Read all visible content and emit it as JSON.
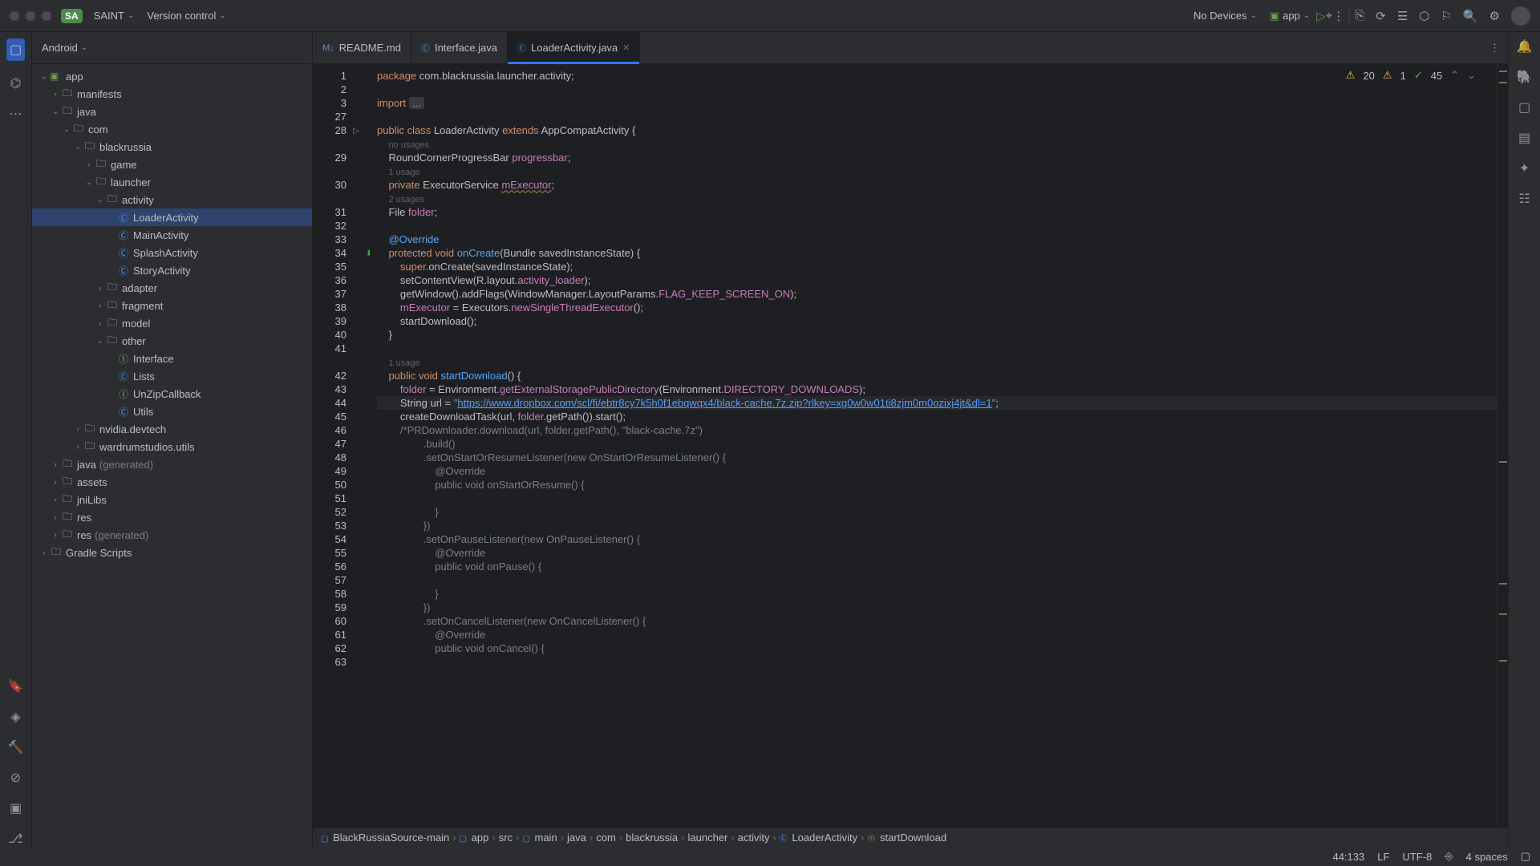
{
  "titlebar": {
    "badge": "SA",
    "workspace": "SAINT",
    "vcs": "Version control",
    "devices": "No Devices",
    "runconfig": "app"
  },
  "sidebar": {
    "header": "Android",
    "tree": [
      {
        "d": 0,
        "t": "v",
        "i": "app",
        "l": "app"
      },
      {
        "d": 1,
        "t": ">",
        "i": "folder",
        "l": "manifests"
      },
      {
        "d": 1,
        "t": "v",
        "i": "folder",
        "l": "java"
      },
      {
        "d": 2,
        "t": "v",
        "i": "folder",
        "l": "com"
      },
      {
        "d": 3,
        "t": "v",
        "i": "folder",
        "l": "blackrussia"
      },
      {
        "d": 4,
        "t": ">",
        "i": "folder",
        "l": "game"
      },
      {
        "d": 4,
        "t": "v",
        "i": "folder",
        "l": "launcher"
      },
      {
        "d": 5,
        "t": "v",
        "i": "folder",
        "l": "activity"
      },
      {
        "d": 6,
        "t": "",
        "i": "cls",
        "l": "LoaderActivity",
        "sel": true
      },
      {
        "d": 6,
        "t": "",
        "i": "cls",
        "l": "MainActivity"
      },
      {
        "d": 6,
        "t": "",
        "i": "cls",
        "l": "SplashActivity"
      },
      {
        "d": 6,
        "t": "",
        "i": "cls",
        "l": "StoryActivity"
      },
      {
        "d": 5,
        "t": ">",
        "i": "folder",
        "l": "adapter"
      },
      {
        "d": 5,
        "t": ">",
        "i": "folder",
        "l": "fragment"
      },
      {
        "d": 5,
        "t": ">",
        "i": "folder",
        "l": "model"
      },
      {
        "d": 5,
        "t": "v",
        "i": "folder",
        "l": "other"
      },
      {
        "d": 6,
        "t": "",
        "i": "iface",
        "l": "Interface"
      },
      {
        "d": 6,
        "t": "",
        "i": "cls",
        "l": "Lists"
      },
      {
        "d": 6,
        "t": "",
        "i": "iface",
        "l": "UnZipCallback"
      },
      {
        "d": 6,
        "t": "",
        "i": "cls",
        "l": "Utils"
      },
      {
        "d": 3,
        "t": ">",
        "i": "folder",
        "l": "nvidia.devtech"
      },
      {
        "d": 3,
        "t": ">",
        "i": "folder",
        "l": "wardrumstudios.utils"
      },
      {
        "d": 1,
        "t": ">",
        "i": "folder",
        "l": "java",
        "dim": "(generated)"
      },
      {
        "d": 1,
        "t": ">",
        "i": "folder",
        "l": "assets"
      },
      {
        "d": 1,
        "t": ">",
        "i": "folder",
        "l": "jniLibs"
      },
      {
        "d": 1,
        "t": ">",
        "i": "folder",
        "l": "res"
      },
      {
        "d": 1,
        "t": ">",
        "i": "folder",
        "l": "res",
        "dim": "(generated)"
      },
      {
        "d": 0,
        "t": ">",
        "i": "folder",
        "l": "Gradle Scripts"
      }
    ]
  },
  "tabs": [
    {
      "icon": "md",
      "label": "README.md",
      "active": false
    },
    {
      "icon": "java",
      "label": "Interface.java",
      "active": false
    },
    {
      "icon": "java",
      "label": "LoaderActivity.java",
      "active": true,
      "close": true
    }
  ],
  "inspections": {
    "warnings": "20",
    "weak": "1",
    "typos": "45"
  },
  "code": [
    {
      "n": 1,
      "h": "<span class='kw'>package</span> com.blackrussia.launcher.activity;"
    },
    {
      "n": 2,
      "h": ""
    },
    {
      "n": 3,
      "h": "<span class='kw'>import</span> <span class='fold'>...</span>"
    },
    {
      "n": 27,
      "h": ""
    },
    {
      "n": 28,
      "run": true,
      "h": "<span class='kw'>public class</span> LoaderActivity <span class='kw'>extends</span> AppCompatActivity {"
    },
    {
      "hint": "no usages"
    },
    {
      "n": 29,
      "h": "    RoundCornerProgressBar <span class='fld'>progressbar</span>;"
    },
    {
      "hint": "1 usage"
    },
    {
      "n": 30,
      "h": "    <span class='kw'>private</span> ExecutorService <span class='fld warn'>mExecutor</span>;"
    },
    {
      "hint": "2 usages"
    },
    {
      "n": 31,
      "h": "    File <span class='fld'>folder</span>;"
    },
    {
      "n": 32,
      "h": ""
    },
    {
      "n": 33,
      "h": "    <span class='fn'>@Override</span>"
    },
    {
      "n": 34,
      "ov": true,
      "h": "    <span class='kw'>protected void</span> <span class='fn'>onCreate</span>(Bundle savedInstanceState) {"
    },
    {
      "n": 35,
      "h": "        <span class='kw'>super</span>.onCreate(savedInstanceState);"
    },
    {
      "n": 36,
      "h": "        setContentView(R.layout.<span class='fld'>activity_loader</span>);"
    },
    {
      "n": 37,
      "h": "        getWindow().addFlags(WindowManager.LayoutParams.<span class='fld'>FLAG_KEEP_SCREEN_ON</span>);"
    },
    {
      "n": 38,
      "h": "        <span class='fld'>mExecutor</span> = Executors.<span class='fld'>newSingleThreadExecutor</span>();"
    },
    {
      "n": 39,
      "h": "        startDownload();"
    },
    {
      "n": 40,
      "h": "    }"
    },
    {
      "n": 41,
      "h": ""
    },
    {
      "hint": "1 usage"
    },
    {
      "n": 42,
      "h": "    <span class='kw'>public void</span> <span class='fn'>startDownload</span>() {"
    },
    {
      "n": 43,
      "h": "        <span class='fld'>folder</span> = Environment.<span class='fld'>getExternalStoragePublicDirectory</span>(Environment.<span class='fld'>DIRECTORY_DOWNLOADS</span>);"
    },
    {
      "n": 44,
      "cur": true,
      "h": "        String url = <span class='str'>\"</span><span class='url'>https://www.dropbox.com/scl/fi/ebtr8cy7k5h0f1ebqwqx4/black-cache.7z.zip?rlkey=xg0w0w01ti8zjm0m0ozixj4jt&dl=1</span><span class='str'>\"</span>;"
    },
    {
      "n": 45,
      "h": "        createDownloadTask(url, <span class='fld'>folder</span>.getPath()).start();"
    },
    {
      "n": 46,
      "h": "        <span class='cmt'>/*PRDownloader.download(url, folder.getPath(), \"black-cache.7z\")</span>"
    },
    {
      "n": 47,
      "h": "<span class='cmt'>                .build()</span>"
    },
    {
      "n": 48,
      "h": "<span class='cmt'>                .setOnStartOrResumeListener(new OnStartOrResumeListener() {</span>"
    },
    {
      "n": 49,
      "h": "<span class='cmt'>                    @Override</span>"
    },
    {
      "n": 50,
      "h": "<span class='cmt'>                    public void onStartOrResume() {</span>"
    },
    {
      "n": 51,
      "h": ""
    },
    {
      "n": 52,
      "h": "<span class='cmt'>                    }</span>"
    },
    {
      "n": 53,
      "h": "<span class='cmt'>                })</span>"
    },
    {
      "n": 54,
      "h": "<span class='cmt'>                .setOnPauseListener(new OnPauseListener() {</span>"
    },
    {
      "n": 55,
      "h": "<span class='cmt'>                    @Override</span>"
    },
    {
      "n": 56,
      "h": "<span class='cmt'>                    public void onPause() {</span>"
    },
    {
      "n": 57,
      "h": ""
    },
    {
      "n": 58,
      "h": "<span class='cmt'>                    }</span>"
    },
    {
      "n": 59,
      "h": "<span class='cmt'>                })</span>"
    },
    {
      "n": 60,
      "h": "<span class='cmt'>                .setOnCancelListener(new OnCancelListener() {</span>"
    },
    {
      "n": 61,
      "h": "<span class='cmt'>                    @Override</span>"
    },
    {
      "n": 62,
      "h": "<span class='cmt'>                    public void onCancel() {</span>"
    },
    {
      "n": 63,
      "h": ""
    }
  ],
  "crumbs": [
    "BlackRussiaSource-main",
    "app",
    "src",
    "main",
    "java",
    "com",
    "blackrussia",
    "launcher",
    "activity",
    "LoaderActivity",
    "startDownload"
  ],
  "status": {
    "pos": "44:133",
    "le": "LF",
    "enc": "UTF-8",
    "indent": "4 spaces"
  }
}
